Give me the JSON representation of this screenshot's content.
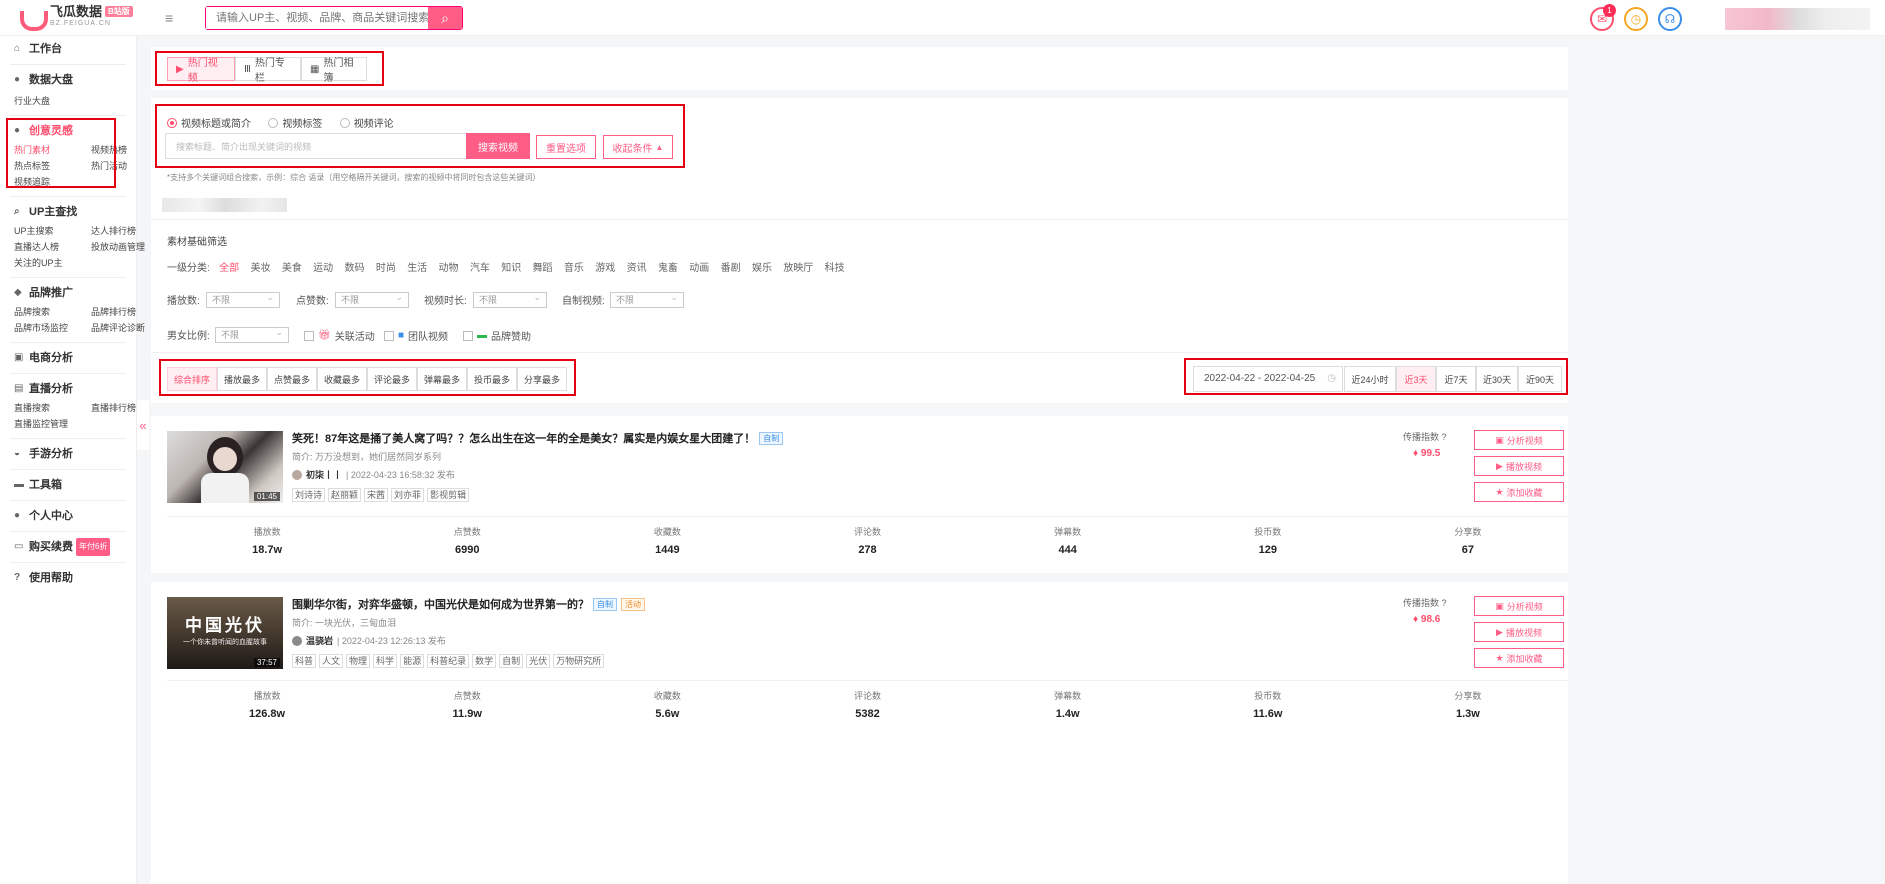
{
  "topbar": {
    "logo_title": "飞瓜数据",
    "logo_badge": "B站版",
    "logo_sub": "BZ.FEIGUA.CN",
    "search_placeholder": "请输入UP主、视频、品牌、商品关键词搜索",
    "msg_count": "1"
  },
  "sidebar": {
    "workbench": "工作台",
    "dashboard": "数据大盘",
    "industry": "行业大盘",
    "creative": "创意灵感",
    "creative_items": [
      "热门素材",
      "视频热榜",
      "热点标签",
      "热门活动",
      "视频追踪"
    ],
    "up_finder": "UP主查找",
    "up_items": [
      "UP主搜索",
      "达人排行榜",
      "直播达人榜",
      "投放动画管理",
      "关注的UP主"
    ],
    "brand": "品牌推广",
    "brand_items": [
      "品牌搜索",
      "品牌排行榜",
      "品牌市场监控",
      "品牌评论诊断"
    ],
    "ecommerce": "电商分析",
    "live": "直播分析",
    "live_items": [
      "直播搜索",
      "直播排行榜",
      "直播监控管理"
    ],
    "mobile_game": "手游分析",
    "toolbox": "工具箱",
    "personal": "个人中心",
    "buy": "购买续费",
    "buy_badge": "年付6折",
    "help": "使用帮助"
  },
  "tabs": [
    "热门视频",
    "热门专栏",
    "热门相簿"
  ],
  "search": {
    "radios": [
      "视频标题或简介",
      "视频标签",
      "视频评论"
    ],
    "placeholder": "搜索标题、简介出现关键词的视频",
    "search_btn": "搜索视频",
    "reset_btn": "重置选项",
    "collapse_btn": "收起条件",
    "hint": "*支持多个关键词组合搜索，示例：综合 语录（用空格隔开关键词，搜索的视频中将同时包含这些关键词）"
  },
  "filters": {
    "section_title": "素材基础筛选",
    "category_label": "一级分类:",
    "categories": [
      "全部",
      "美妆",
      "美食",
      "运动",
      "数码",
      "时尚",
      "生活",
      "动物",
      "汽车",
      "知识",
      "舞蹈",
      "音乐",
      "游戏",
      "资讯",
      "鬼畜",
      "动画",
      "番剧",
      "娱乐",
      "放映厅",
      "科技"
    ],
    "play_label": "播放数:",
    "like_label": "点赞数:",
    "dur_label": "视频时长:",
    "self_label": "自制视频:",
    "gender_label": "男女比例:",
    "any": "不限",
    "cb_activity": "关联活动",
    "cb_team": "团队视频",
    "cb_brand": "品牌赞助"
  },
  "sort": {
    "buttons": [
      "综合排序",
      "播放最多",
      "点赞最多",
      "收藏最多",
      "评论最多",
      "弹幕最多",
      "投币最多",
      "分享最多"
    ],
    "date_range": "2022-04-22 - 2022-04-25",
    "ranges": [
      "近24小时",
      "近3天",
      "近7天",
      "近30天",
      "近90天"
    ]
  },
  "stat_labels": [
    "播放数",
    "点赞数",
    "收藏数",
    "评论数",
    "弹幕数",
    "投币数",
    "分享数"
  ],
  "actions": {
    "analyze": "分析视频",
    "play": "播放视频",
    "fav": "添加收藏",
    "index_label": "传播指数"
  },
  "videos": [
    {
      "title": "笑死！87年这是捅了美人窝了吗？？怎么出生在这一年的全是美女？属实是内娱女星大团建了！",
      "badge1": "自制",
      "desc_label": "简介:",
      "desc": "万万没想到，她们居然同岁系列",
      "author": "初柒丨丨",
      "time": "| 2022-04-23 16:58:32 发布",
      "tags": [
        "刘诗诗",
        "赵丽颖",
        "宋茜",
        "刘亦菲",
        "影视剪辑"
      ],
      "duration": "01:45",
      "index": "99.5",
      "stats": [
        "18.7w",
        "6990",
        "1449",
        "278",
        "444",
        "129",
        "67"
      ]
    },
    {
      "title": "围剿华尔街，对弈华盛顿，中国光伏是如何成为世界第一的？",
      "badge1": "自制",
      "badge2": "活动",
      "desc_label": "简介:",
      "desc": "一块光伏，三甸血泪",
      "author": "温骁岩",
      "time": "| 2022-04-23 12:26:13 发布",
      "tags": [
        "科普",
        "人文",
        "物理",
        "科学",
        "能源",
        "科普纪录",
        "数学",
        "自制",
        "光伏",
        "万物研究所"
      ],
      "duration": "37:57",
      "thumb_title": "中国光伏",
      "thumb_sub": "一个你未曾听闻的血腥故事",
      "index": "98.6",
      "stats": [
        "126.8w",
        "11.9w",
        "5.6w",
        "5382",
        "1.4w",
        "11.6w",
        "1.3w"
      ]
    }
  ]
}
